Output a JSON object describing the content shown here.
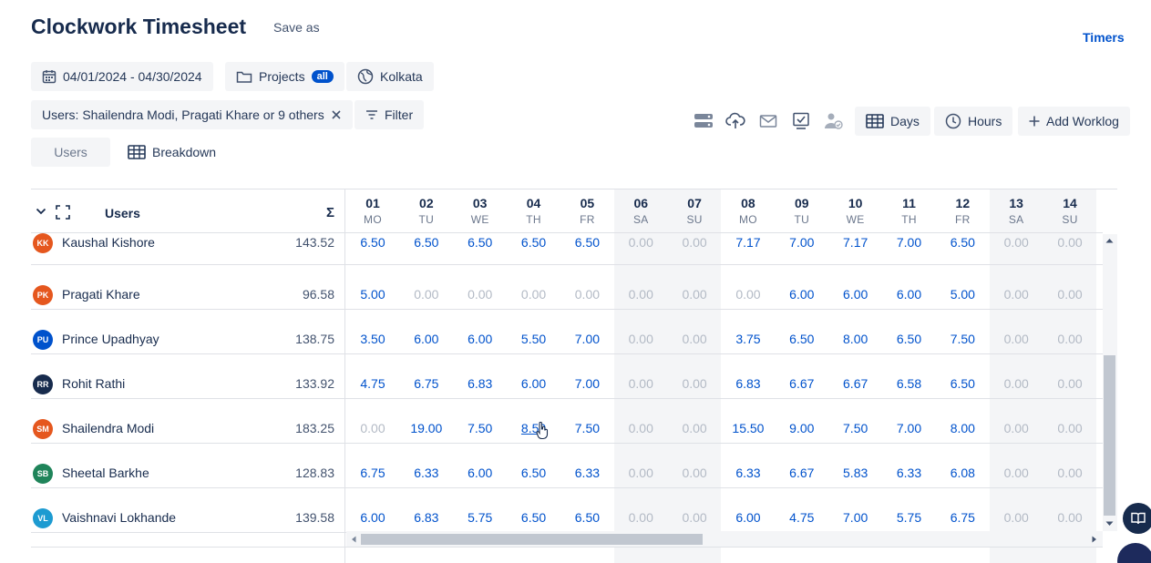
{
  "header": {
    "title": "Clockwork Timesheet",
    "save_as": "Save as",
    "timers": "Timers"
  },
  "filters": {
    "date_range": "04/01/2024 - 04/30/2024",
    "projects_label": "Projects",
    "projects_badge": "all",
    "timezone": "Kolkata",
    "users_filter": "Users: Shailendra Modi, Pragati Khare or 9 others",
    "filter_label": "Filter"
  },
  "toolbar": {
    "days_label": "Days",
    "hours_label": "Hours",
    "add_worklog_label": "Add Worklog"
  },
  "grouping": {
    "users_tab": "Users",
    "breakdown_label": "Breakdown"
  },
  "grid": {
    "users_header": "Users",
    "sigma": "Σ",
    "days": [
      {
        "num": "01",
        "wd": "MO",
        "weekend": false
      },
      {
        "num": "02",
        "wd": "TU",
        "weekend": false
      },
      {
        "num": "03",
        "wd": "WE",
        "weekend": false
      },
      {
        "num": "04",
        "wd": "TH",
        "weekend": false
      },
      {
        "num": "05",
        "wd": "FR",
        "weekend": false
      },
      {
        "num": "06",
        "wd": "SA",
        "weekend": true
      },
      {
        "num": "07",
        "wd": "SU",
        "weekend": true
      },
      {
        "num": "08",
        "wd": "MO",
        "weekend": false
      },
      {
        "num": "09",
        "wd": "TU",
        "weekend": false
      },
      {
        "num": "10",
        "wd": "WE",
        "weekend": false
      },
      {
        "num": "11",
        "wd": "TH",
        "weekend": false
      },
      {
        "num": "12",
        "wd": "FR",
        "weekend": false
      },
      {
        "num": "13",
        "wd": "SA",
        "weekend": true
      },
      {
        "num": "14",
        "wd": "SU",
        "weekend": true
      }
    ],
    "rows": [
      {
        "initials": "KK",
        "color": "#e5571e",
        "name": "Kaushal Kishore",
        "total": "143.52",
        "values": [
          "6.50",
          "6.50",
          "6.50",
          "6.50",
          "6.50",
          "0.00",
          "0.00",
          "7.17",
          "7.00",
          "7.17",
          "7.00",
          "6.50",
          "0.00",
          "0.00"
        ]
      },
      {
        "initials": "PK",
        "color": "#e5571e",
        "name": "Pragati Khare",
        "total": "96.58",
        "values": [
          "5.00",
          "0.00",
          "0.00",
          "0.00",
          "0.00",
          "0.00",
          "0.00",
          "0.00",
          "6.00",
          "6.00",
          "6.00",
          "5.00",
          "0.00",
          "0.00"
        ]
      },
      {
        "initials": "PU",
        "color": "#0052cc",
        "name": "Prince Upadhyay",
        "total": "138.75",
        "values": [
          "3.50",
          "6.00",
          "6.00",
          "5.50",
          "7.00",
          "0.00",
          "0.00",
          "3.75",
          "6.50",
          "8.00",
          "6.50",
          "7.50",
          "0.00",
          "0.00"
        ]
      },
      {
        "initials": "RR",
        "color": "#172b4d",
        "name": "Rohit Rathi",
        "total": "133.92",
        "values": [
          "4.75",
          "6.75",
          "6.83",
          "6.00",
          "7.00",
          "0.00",
          "0.00",
          "6.83",
          "6.67",
          "6.67",
          "6.58",
          "6.50",
          "0.00",
          "0.00"
        ]
      },
      {
        "initials": "SM",
        "color": "#e5571e",
        "name": "Shailendra Modi",
        "total": "183.25",
        "values": [
          "0.00",
          "19.00",
          "7.50",
          "8.50",
          "7.50",
          "0.00",
          "0.00",
          "15.50",
          "9.00",
          "7.50",
          "7.00",
          "8.00",
          "0.00",
          "0.00"
        ]
      },
      {
        "initials": "SB",
        "color": "#1f845a",
        "name": "Sheetal Barkhe",
        "total": "128.83",
        "values": [
          "6.75",
          "6.33",
          "6.00",
          "6.50",
          "6.33",
          "0.00",
          "0.00",
          "6.33",
          "6.67",
          "5.83",
          "6.33",
          "6.08",
          "0.00",
          "0.00"
        ]
      },
      {
        "initials": "VL",
        "color": "#1d9bd1",
        "name": "Vaishnavi Lokhande",
        "total": "139.58",
        "values": [
          "6.00",
          "6.83",
          "5.75",
          "6.50",
          "6.50",
          "0.00",
          "0.00",
          "6.00",
          "4.75",
          "7.00",
          "5.75",
          "6.75",
          "0.00",
          "0.00"
        ]
      }
    ]
  }
}
